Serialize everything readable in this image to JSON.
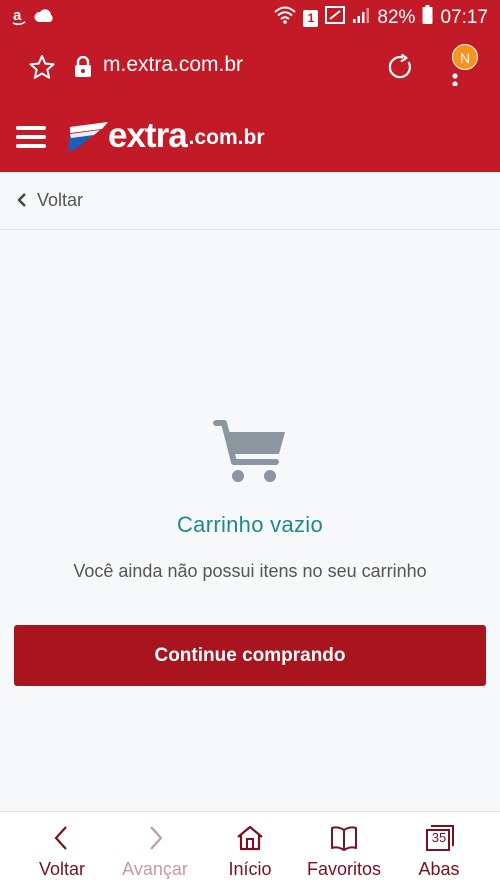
{
  "status_bar": {
    "left_icons": [
      "amazon-notification-icon",
      "weather-icon"
    ],
    "sim_label": "1",
    "battery": "82%",
    "time": "07:17"
  },
  "browser": {
    "url": "m.extra.com.br",
    "avatar_letter": "N"
  },
  "site": {
    "logo_word": "extra",
    "logo_domain": ".com.br"
  },
  "back": {
    "label": "Voltar"
  },
  "cart": {
    "title": "Carrinho vazio",
    "message": "Você ainda não possui itens no seu carrinho",
    "button_label": "Continue comprando"
  },
  "bottom_nav": {
    "items": [
      {
        "label": "Voltar",
        "icon": "chevron-left-icon"
      },
      {
        "label": "Avançar",
        "icon": "chevron-right-icon"
      },
      {
        "label": "Início",
        "icon": "home-icon"
      },
      {
        "label": "Favoritos",
        "icon": "bookmarks-icon"
      },
      {
        "label": "Abas",
        "icon": "tabs-icon"
      }
    ],
    "tabs_count": "35"
  },
  "colors": {
    "brand_red": "#c21a26",
    "button_red": "#a8151f",
    "title_teal": "#1e8a86",
    "badge_orange": "#f7931e"
  }
}
